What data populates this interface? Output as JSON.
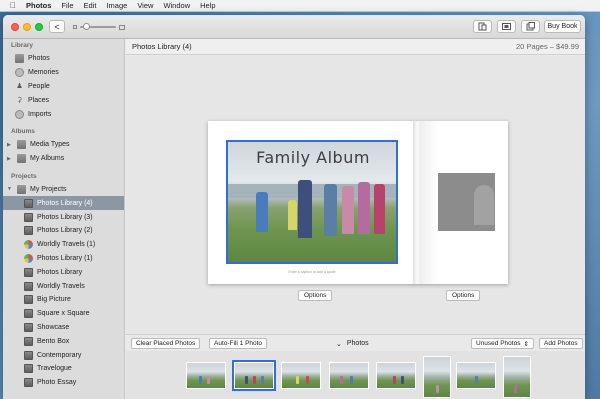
{
  "menubar": {
    "apple": "",
    "app_name": "Photos",
    "items": [
      "File",
      "Edit",
      "Image",
      "View",
      "Window",
      "Help"
    ]
  },
  "toolbar": {
    "back_glyph": "<",
    "buy_book_label": "Buy Book"
  },
  "sidebar": {
    "library_header": "Library",
    "library_items": [
      {
        "label": "Photos",
        "icon": "photos-icon"
      },
      {
        "label": "Memories",
        "icon": "memories-icon"
      },
      {
        "label": "People",
        "icon": "people-icon"
      },
      {
        "label": "Places",
        "icon": "places-icon"
      },
      {
        "label": "Imports",
        "icon": "imports-icon"
      }
    ],
    "albums_header": "Albums",
    "album_items": [
      {
        "label": "Media Types",
        "icon": "folder-icon"
      },
      {
        "label": "My Albums",
        "icon": "folder-icon"
      }
    ],
    "projects_header": "Projects",
    "projects_root": "My Projects",
    "project_items": [
      {
        "label": "Photos Library (4)",
        "icon": "book-icon",
        "selected": true
      },
      {
        "label": "Photos Library (3)",
        "icon": "book-icon"
      },
      {
        "label": "Photos Library (2)",
        "icon": "book-icon"
      },
      {
        "label": "Worldly Travels (1)",
        "icon": "globe-icon"
      },
      {
        "label": "Photos Library (1)",
        "icon": "globe-icon"
      },
      {
        "label": "Photos Library",
        "icon": "book-icon"
      },
      {
        "label": "Worldly Travels",
        "icon": "book-icon"
      },
      {
        "label": "Big Picture",
        "icon": "book-icon"
      },
      {
        "label": "Square x Square",
        "icon": "book-icon"
      },
      {
        "label": "Showcase",
        "icon": "book-icon"
      },
      {
        "label": "Bento Box",
        "icon": "book-icon"
      },
      {
        "label": "Contemporary",
        "icon": "book-icon"
      },
      {
        "label": "Travelogue",
        "icon": "book-icon"
      },
      {
        "label": "Photo Essay",
        "icon": "book-icon"
      }
    ]
  },
  "main": {
    "title": "Photos Library (4)",
    "page_info": "20 Pages – $49.99",
    "book": {
      "album_title": "Family Album",
      "caption": "Enter a caption or add a quote"
    },
    "options_left": "Options",
    "options_right": "Options"
  },
  "bottombar": {
    "clear_label": "Clear Placed Photos",
    "autofill_label": "Auto-Fill 1 Photo",
    "photos_label": "Photos",
    "unused_label": "Unused Photos",
    "add_label": "Add Photos"
  },
  "filmstrip": {
    "count": 8,
    "selected_index": 1
  },
  "colors": {
    "selection_blue": "#2f6fd6",
    "sidebar_selected": "#8c97a4"
  }
}
